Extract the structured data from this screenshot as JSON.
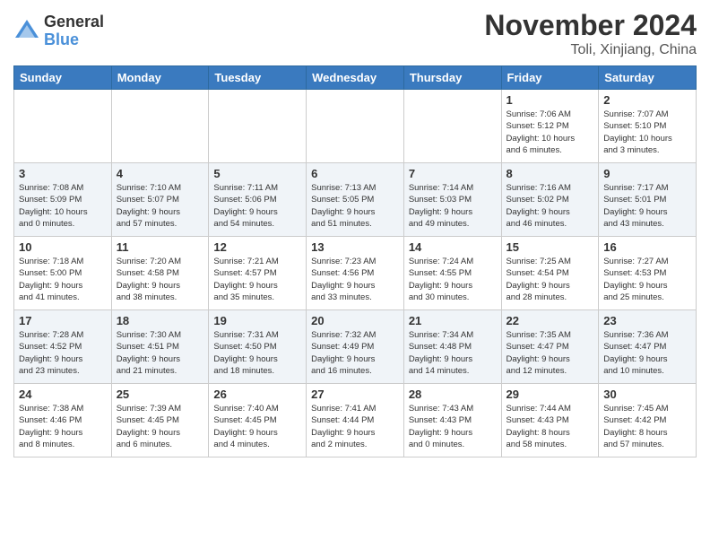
{
  "logo": {
    "general": "General",
    "blue": "Blue"
  },
  "title": "November 2024",
  "location": "Toli, Xinjiang, China",
  "days_of_week": [
    "Sunday",
    "Monday",
    "Tuesday",
    "Wednesday",
    "Thursday",
    "Friday",
    "Saturday"
  ],
  "weeks": [
    [
      {
        "day": "",
        "info": ""
      },
      {
        "day": "",
        "info": ""
      },
      {
        "day": "",
        "info": ""
      },
      {
        "day": "",
        "info": ""
      },
      {
        "day": "",
        "info": ""
      },
      {
        "day": "1",
        "info": "Sunrise: 7:06 AM\nSunset: 5:12 PM\nDaylight: 10 hours\nand 6 minutes."
      },
      {
        "day": "2",
        "info": "Sunrise: 7:07 AM\nSunset: 5:10 PM\nDaylight: 10 hours\nand 3 minutes."
      }
    ],
    [
      {
        "day": "3",
        "info": "Sunrise: 7:08 AM\nSunset: 5:09 PM\nDaylight: 10 hours\nand 0 minutes."
      },
      {
        "day": "4",
        "info": "Sunrise: 7:10 AM\nSunset: 5:07 PM\nDaylight: 9 hours\nand 57 minutes."
      },
      {
        "day": "5",
        "info": "Sunrise: 7:11 AM\nSunset: 5:06 PM\nDaylight: 9 hours\nand 54 minutes."
      },
      {
        "day": "6",
        "info": "Sunrise: 7:13 AM\nSunset: 5:05 PM\nDaylight: 9 hours\nand 51 minutes."
      },
      {
        "day": "7",
        "info": "Sunrise: 7:14 AM\nSunset: 5:03 PM\nDaylight: 9 hours\nand 49 minutes."
      },
      {
        "day": "8",
        "info": "Sunrise: 7:16 AM\nSunset: 5:02 PM\nDaylight: 9 hours\nand 46 minutes."
      },
      {
        "day": "9",
        "info": "Sunrise: 7:17 AM\nSunset: 5:01 PM\nDaylight: 9 hours\nand 43 minutes."
      }
    ],
    [
      {
        "day": "10",
        "info": "Sunrise: 7:18 AM\nSunset: 5:00 PM\nDaylight: 9 hours\nand 41 minutes."
      },
      {
        "day": "11",
        "info": "Sunrise: 7:20 AM\nSunset: 4:58 PM\nDaylight: 9 hours\nand 38 minutes."
      },
      {
        "day": "12",
        "info": "Sunrise: 7:21 AM\nSunset: 4:57 PM\nDaylight: 9 hours\nand 35 minutes."
      },
      {
        "day": "13",
        "info": "Sunrise: 7:23 AM\nSunset: 4:56 PM\nDaylight: 9 hours\nand 33 minutes."
      },
      {
        "day": "14",
        "info": "Sunrise: 7:24 AM\nSunset: 4:55 PM\nDaylight: 9 hours\nand 30 minutes."
      },
      {
        "day": "15",
        "info": "Sunrise: 7:25 AM\nSunset: 4:54 PM\nDaylight: 9 hours\nand 28 minutes."
      },
      {
        "day": "16",
        "info": "Sunrise: 7:27 AM\nSunset: 4:53 PM\nDaylight: 9 hours\nand 25 minutes."
      }
    ],
    [
      {
        "day": "17",
        "info": "Sunrise: 7:28 AM\nSunset: 4:52 PM\nDaylight: 9 hours\nand 23 minutes."
      },
      {
        "day": "18",
        "info": "Sunrise: 7:30 AM\nSunset: 4:51 PM\nDaylight: 9 hours\nand 21 minutes."
      },
      {
        "day": "19",
        "info": "Sunrise: 7:31 AM\nSunset: 4:50 PM\nDaylight: 9 hours\nand 18 minutes."
      },
      {
        "day": "20",
        "info": "Sunrise: 7:32 AM\nSunset: 4:49 PM\nDaylight: 9 hours\nand 16 minutes."
      },
      {
        "day": "21",
        "info": "Sunrise: 7:34 AM\nSunset: 4:48 PM\nDaylight: 9 hours\nand 14 minutes."
      },
      {
        "day": "22",
        "info": "Sunrise: 7:35 AM\nSunset: 4:47 PM\nDaylight: 9 hours\nand 12 minutes."
      },
      {
        "day": "23",
        "info": "Sunrise: 7:36 AM\nSunset: 4:47 PM\nDaylight: 9 hours\nand 10 minutes."
      }
    ],
    [
      {
        "day": "24",
        "info": "Sunrise: 7:38 AM\nSunset: 4:46 PM\nDaylight: 9 hours\nand 8 minutes."
      },
      {
        "day": "25",
        "info": "Sunrise: 7:39 AM\nSunset: 4:45 PM\nDaylight: 9 hours\nand 6 minutes."
      },
      {
        "day": "26",
        "info": "Sunrise: 7:40 AM\nSunset: 4:45 PM\nDaylight: 9 hours\nand 4 minutes."
      },
      {
        "day": "27",
        "info": "Sunrise: 7:41 AM\nSunset: 4:44 PM\nDaylight: 9 hours\nand 2 minutes."
      },
      {
        "day": "28",
        "info": "Sunrise: 7:43 AM\nSunset: 4:43 PM\nDaylight: 9 hours\nand 0 minutes."
      },
      {
        "day": "29",
        "info": "Sunrise: 7:44 AM\nSunset: 4:43 PM\nDaylight: 8 hours\nand 58 minutes."
      },
      {
        "day": "30",
        "info": "Sunrise: 7:45 AM\nSunset: 4:42 PM\nDaylight: 8 hours\nand 57 minutes."
      }
    ]
  ]
}
